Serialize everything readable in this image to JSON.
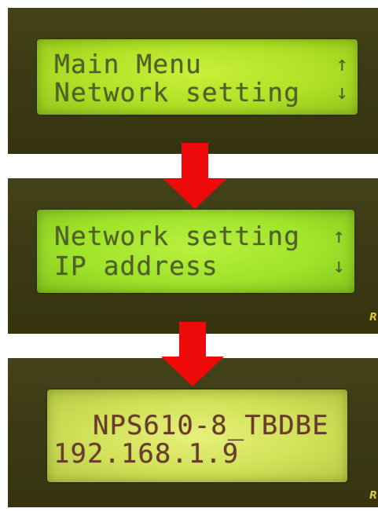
{
  "screens": [
    {
      "line1": "Main Menu",
      "line1_arrow": "↑",
      "line2": "Network setting",
      "line2_arrow": "↓"
    },
    {
      "line1": "Network setting",
      "line1_arrow": "↑",
      "line2": "IP address",
      "line2_arrow": "↓"
    },
    {
      "line1": "NPS610-8_TBDBE",
      "line2": "192.168.1.9"
    }
  ],
  "edge_label": "R",
  "colors": {
    "flow_arrow": "#ee0a0a",
    "bezel": "#3d3c15",
    "lcd_green": "#afe025",
    "lcd_yellow": "#d2e25a"
  },
  "icons": {
    "flow_arrow": "down-arrow-icon",
    "scroll_up": "up-arrow-icon",
    "scroll_down": "down-arrow-icon"
  }
}
